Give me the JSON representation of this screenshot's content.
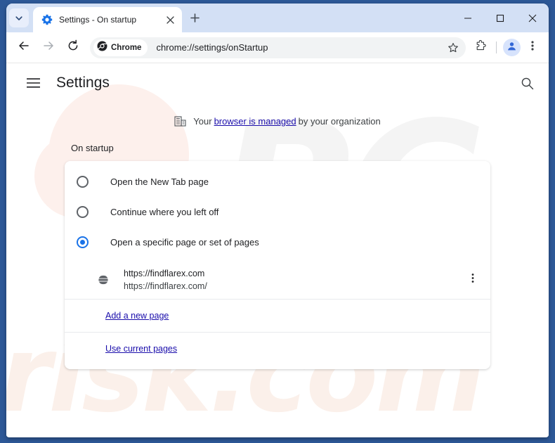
{
  "window": {
    "controls": {
      "minimize": "minimize-label",
      "maximize": "maximize-label",
      "close": "close-label"
    }
  },
  "tab_strip": {
    "tab_search_icon": "chevron-down-icon",
    "new_tab_icon": "plus-icon",
    "tabs": [
      {
        "title": "Settings - On startup",
        "favicon": "settings-gear-icon",
        "close_icon": "close-icon",
        "active": true
      }
    ]
  },
  "toolbar": {
    "back_icon": "arrow-back-icon",
    "forward_icon": "arrow-forward-icon",
    "reload_icon": "reload-icon",
    "chrome_chip_label": "Chrome",
    "chrome_chip_icon": "chrome-logo-icon",
    "url": "chrome://settings/onStartup",
    "bookmark_icon": "star-icon",
    "extensions_icon": "puzzle-piece-icon",
    "profile_icon": "person-avatar-icon",
    "menu_icon": "three-dot-menu-icon"
  },
  "settings": {
    "hamburger_icon": "hamburger-menu-icon",
    "title": "Settings",
    "search_icon": "search-icon",
    "managed_notice": {
      "icon": "enterprise-building-icon",
      "prefix": "Your",
      "link": "browser is managed",
      "suffix": "by your organization"
    },
    "section_heading": "On startup",
    "radio_options": [
      {
        "label": "Open the New Tab page",
        "selected": false
      },
      {
        "label": "Continue where you left off",
        "selected": false
      },
      {
        "label": "Open a specific page or set of pages",
        "selected": true
      }
    ],
    "startup_pages": [
      {
        "favicon": "globe-icon",
        "title": "https://findflarex.com",
        "url": "https://findflarex.com/",
        "menu_icon": "three-dot-menu-icon"
      }
    ],
    "add_page_link": "Add a new page",
    "use_current_pages_link": "Use current pages"
  },
  "watermark": {
    "top_text": "PC",
    "bottom_text": "risk.com"
  },
  "colors": {
    "accent": "#1a73e8",
    "link": "#1a0dab",
    "tab_strip": "#d3e0f5",
    "frame": "#2d5897"
  }
}
